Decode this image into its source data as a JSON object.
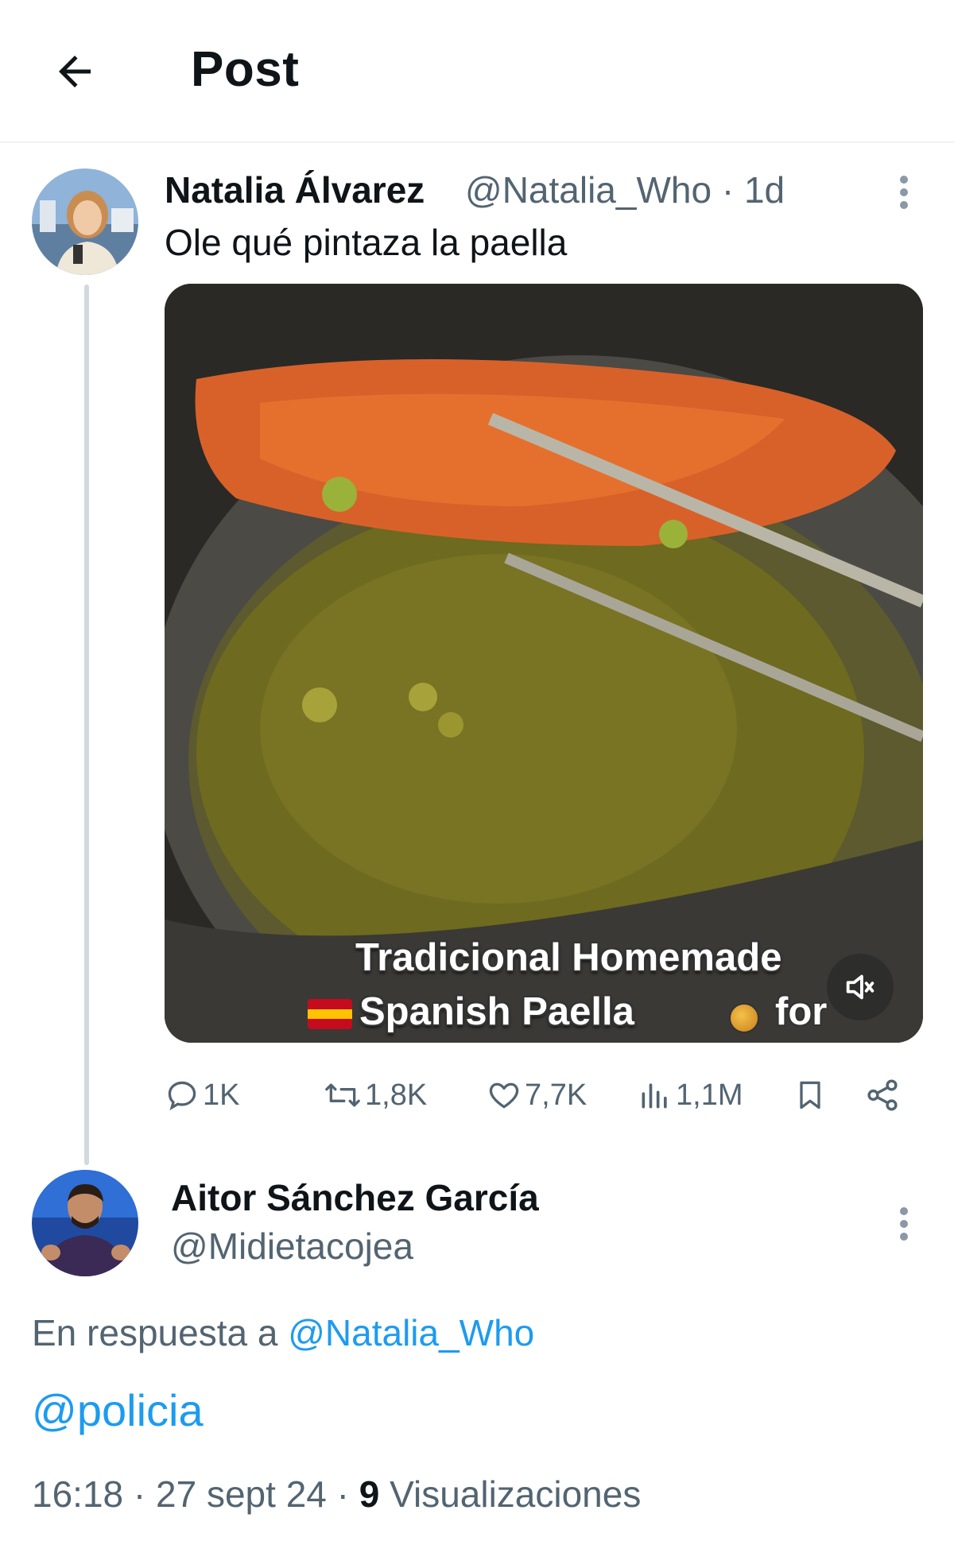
{
  "header": {
    "title": "Post",
    "back_icon": "arrow-left-icon"
  },
  "tweet": {
    "author_name": "Natalia Álvarez",
    "author_handle": "@Natalia_Who",
    "separator": "·",
    "age": "1d",
    "text": "Ole qué pintaza la paella",
    "media": {
      "caption_line1": "Tradicional Homemade",
      "caption_line2": "Spanish Paella",
      "caption_tail": "for",
      "mute_icon": "volume-muted-icon"
    },
    "actions": {
      "replies": "1K",
      "reposts": "1,8K",
      "likes": "7,7K",
      "views": "1,1M"
    }
  },
  "reply": {
    "author_name": "Aitor Sánchez García",
    "author_handle": "@Midietacojea",
    "in_reply_prefix": "En respuesta a",
    "in_reply_handle": "@Natalia_Who",
    "text": "@policia",
    "time": "16:18",
    "date": "27 sept 24",
    "views_count": "9",
    "views_label": "Visualizaciones"
  },
  "colors": {
    "link": "#1d9bf0",
    "secondary_text": "#536471",
    "primary_text": "#0f1419",
    "thread_line": "#cfd9de"
  }
}
